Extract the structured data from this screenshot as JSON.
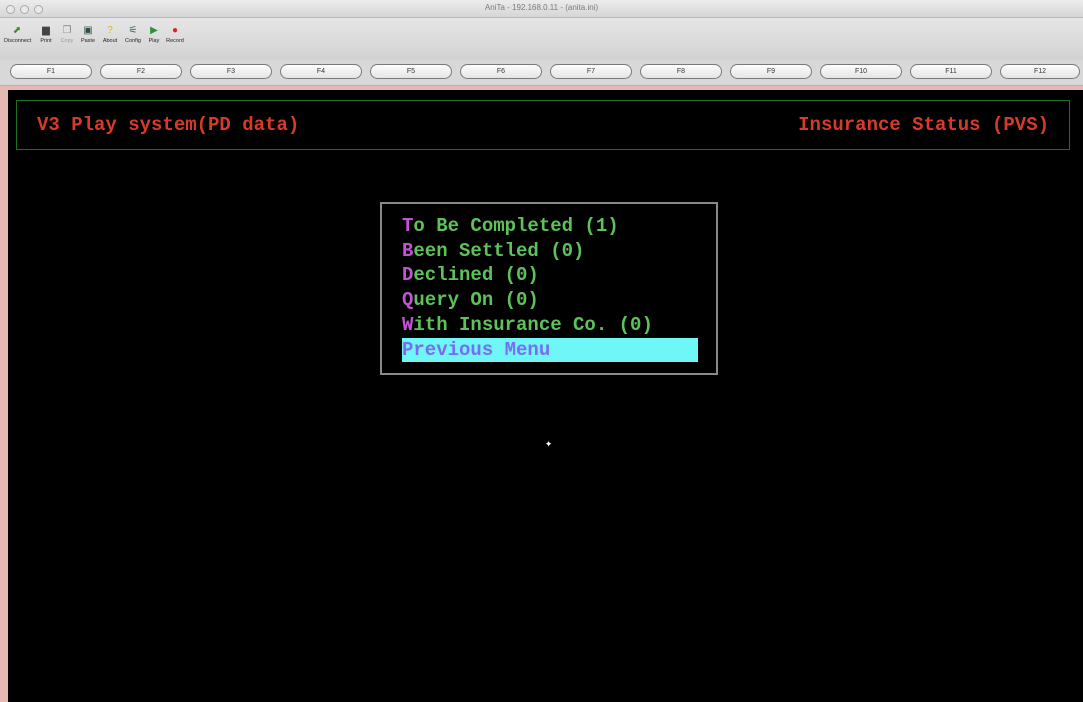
{
  "window": {
    "title": "AniTa - 192.168.0.11 - (anita.ini)"
  },
  "toolbar": {
    "buttons": [
      {
        "label": "Disconnect",
        "icon": "disconnect-icon"
      },
      {
        "label": "Print",
        "icon": "printer-icon"
      },
      {
        "label": "Copy",
        "icon": "copy-icon"
      },
      {
        "label": "Paste",
        "icon": "paste-icon"
      },
      {
        "label": "About",
        "icon": "question-icon"
      },
      {
        "label": "Config",
        "icon": "config-icon"
      },
      {
        "label": "Play",
        "icon": "play-icon"
      },
      {
        "label": "Record",
        "icon": "record-icon"
      }
    ]
  },
  "function_keys": [
    "F1",
    "F2",
    "F3",
    "F4",
    "F5",
    "F6",
    "F7",
    "F8",
    "F9",
    "F10",
    "F11",
    "F12"
  ],
  "terminal": {
    "header_left": "V3 Play system(PD data)",
    "header_right": "Insurance Status (PVS)",
    "menu": [
      {
        "hot": "T",
        "rest": "o Be Completed (1)"
      },
      {
        "hot": "B",
        "rest": "een Settled (0)"
      },
      {
        "hot": "D",
        "rest": "eclined (0)"
      },
      {
        "hot": "Q",
        "rest": "uery On (0)"
      },
      {
        "hot": "W",
        "rest": "ith Insurance Co. (0)"
      },
      {
        "label": "Previous Menu"
      }
    ]
  },
  "colors": {
    "terminal_bg": "#000000",
    "header_text": "#d73a2a",
    "menu_text": "#5ec25a",
    "hotkey": "#c254d6",
    "selected_bg": "#6ff6f6",
    "selected_text": "#7a6cf2"
  }
}
